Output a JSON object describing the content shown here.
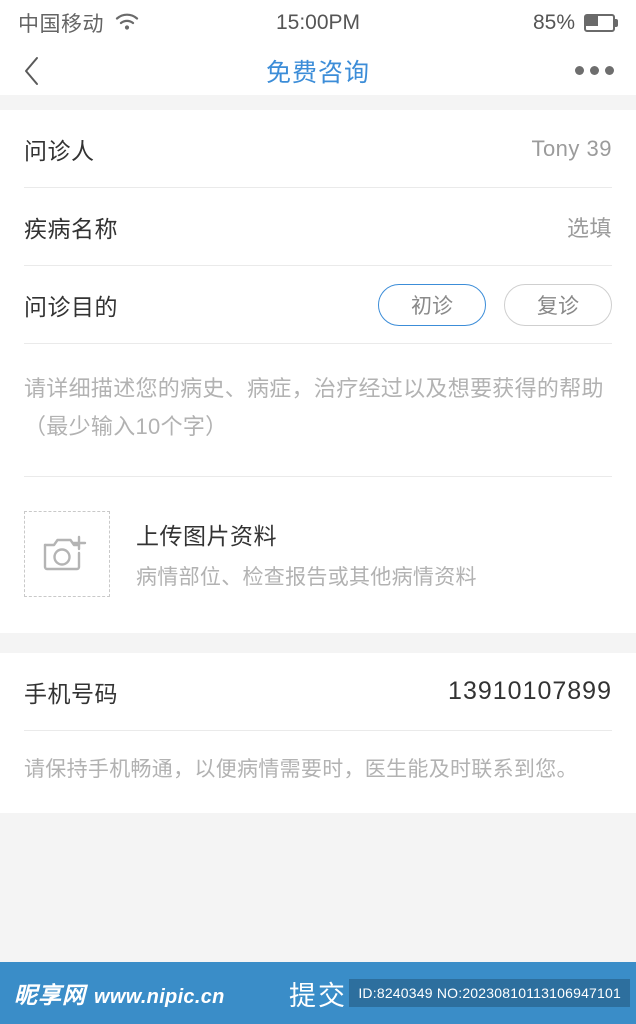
{
  "status_bar": {
    "carrier": "中国移动",
    "wifi_icon": "wifi-icon",
    "time": "15:00PM",
    "battery_percent": "85%",
    "battery_icon": "battery-icon"
  },
  "nav": {
    "back_icon": "chevron-left-icon",
    "title": "免费咨询",
    "more_icon": "more-dots-icon"
  },
  "form": {
    "patient": {
      "label": "问诊人",
      "value": "Tony 39"
    },
    "disease": {
      "label": "疾病名称",
      "value": "选填"
    },
    "purpose": {
      "label": "问诊目的",
      "options": [
        {
          "label": "初诊",
          "selected": true
        },
        {
          "label": "复诊",
          "selected": false
        }
      ]
    },
    "description_placeholder": "请详细描述您的病史、病症，治疗经过以及想要获得的帮助（最少输入10个字）",
    "upload": {
      "icon": "camera-plus-icon",
      "title": "上传图片资料",
      "subtitle": "病情部位、检查报告或其他病情资料"
    }
  },
  "phone_section": {
    "label": "手机号码",
    "value": "13910107899",
    "hint": "请保持手机畅通，以便病情需要时，医生能及时联系到您。"
  },
  "bottom_bar": {
    "submit_label": "提交",
    "watermark_logo": "昵享网",
    "watermark_url": "www.nipic.cn",
    "watermark_id": "ID:8240349 NO:20230810113106947101"
  },
  "colors": {
    "accent": "#3c8dd8",
    "bottom_bar": "#3a8dc8",
    "page_bg": "#f4f4f4",
    "card_bg": "#ffffff",
    "label_text": "#333333",
    "muted_text": "#b2b2b2"
  }
}
